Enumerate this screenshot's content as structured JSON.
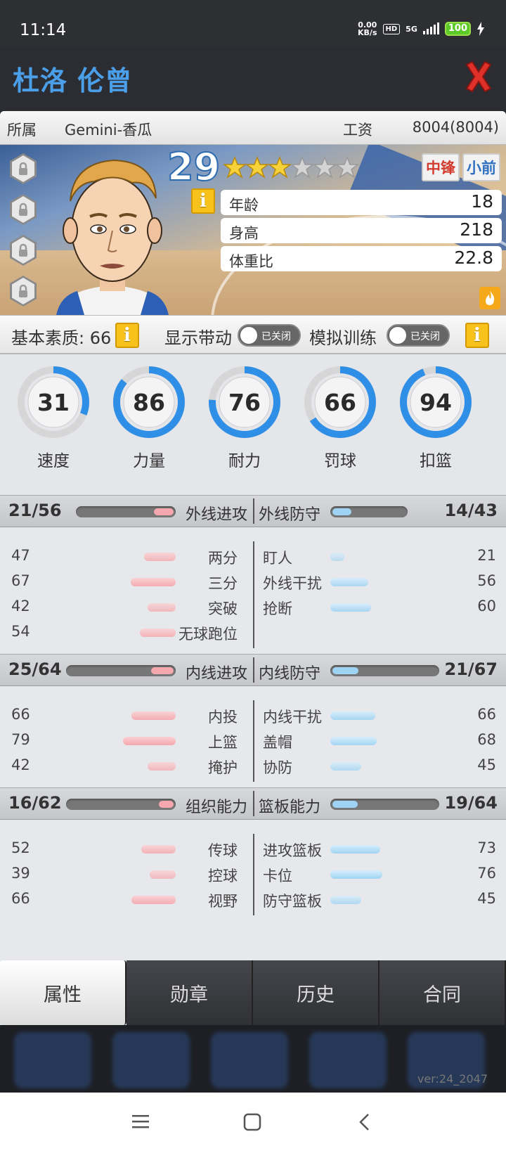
{
  "status_bar": {
    "time": "11:14",
    "net_speed_value": "0.00",
    "net_speed_unit": "KB/s",
    "hd": "HD",
    "network": "5G",
    "battery": "100"
  },
  "header": {
    "player_name": "杜洛 伦曾"
  },
  "info_bar": {
    "team_label": "所属",
    "team_value": "Gemini-香瓜",
    "salary_label": "工资",
    "salary_value": "8004(8004)"
  },
  "player": {
    "overall": "29",
    "stars_filled": 3,
    "stars_total": 6,
    "positions": [
      {
        "label": "中锋",
        "color": "#d33b2f"
      },
      {
        "label": "小前",
        "color": "#2f6fc2"
      }
    ],
    "attrs": [
      {
        "label": "年龄",
        "value": "18"
      },
      {
        "label": "身高",
        "value": "218"
      },
      {
        "label": "体重比",
        "value": "22.8"
      }
    ]
  },
  "base_bar": {
    "base_label": "基本素质: 66",
    "show_drive_label": "显示带动",
    "show_drive_state": "已关闭",
    "sim_train_label": "模拟训练",
    "sim_train_state": "已关闭"
  },
  "dials": [
    {
      "label": "速度",
      "value": 31
    },
    {
      "label": "力量",
      "value": 86
    },
    {
      "label": "耐力",
      "value": 76
    },
    {
      "label": "罚球",
      "value": 66
    },
    {
      "label": "扣篮",
      "value": 94
    }
  ],
  "groups": [
    {
      "left_score": "21/56",
      "left_title": "外线进攻",
      "left_ratio": 0.375,
      "right_title": "外线防守",
      "right_score": "14/43",
      "right_ratio": 0.33,
      "left_rows": [
        {
          "label": "两分",
          "value": 47
        },
        {
          "label": "三分",
          "value": 67
        },
        {
          "label": "突破",
          "value": 42
        },
        {
          "label": "无球跑位",
          "value": 54
        }
      ],
      "right_rows": [
        {
          "label": "盯人",
          "value": 21
        },
        {
          "label": "外线干扰",
          "value": 56
        },
        {
          "label": "抢断",
          "value": 60
        }
      ]
    },
    {
      "left_score": "25/64",
      "left_title": "内线进攻",
      "left_ratio": 0.39,
      "right_title": "内线防守",
      "right_score": "21/67",
      "right_ratio": 0.31,
      "left_rows": [
        {
          "label": "内投",
          "value": 66
        },
        {
          "label": "上篮",
          "value": 79
        },
        {
          "label": "掩护",
          "value": 42
        }
      ],
      "right_rows": [
        {
          "label": "内线干扰",
          "value": 66
        },
        {
          "label": "盖帽",
          "value": 68
        },
        {
          "label": "协防",
          "value": 45
        }
      ]
    },
    {
      "left_score": "16/62",
      "left_title": "组织能力",
      "left_ratio": 0.26,
      "right_title": "篮板能力",
      "right_score": "19/64",
      "right_ratio": 0.3,
      "left_rows": [
        {
          "label": "传球",
          "value": 52
        },
        {
          "label": "控球",
          "value": 39
        },
        {
          "label": "视野",
          "value": 66
        }
      ],
      "right_rows": [
        {
          "label": "进攻篮板",
          "value": 73
        },
        {
          "label": "卡位",
          "value": 76
        },
        {
          "label": "防守篮板",
          "value": 45
        }
      ]
    }
  ],
  "tabs": [
    {
      "label": "属性",
      "active": true
    },
    {
      "label": "勋章",
      "active": false
    },
    {
      "label": "历史",
      "active": false
    },
    {
      "label": "合同",
      "active": false
    }
  ],
  "version": "ver:24_2047",
  "colors": {
    "accent_blue": "#2f8fe6",
    "name_blue": "#4a9fe8",
    "close_red": "#e0302a",
    "pink_bar": "#f4a7ac",
    "blue_bar": "#9fd3f3"
  }
}
